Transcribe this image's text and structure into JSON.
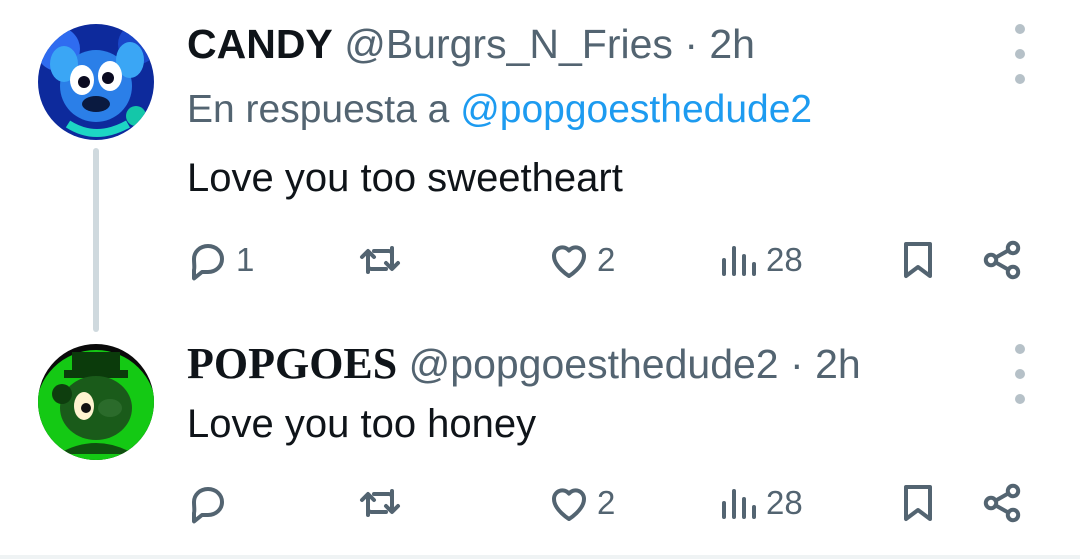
{
  "tweets": [
    {
      "display_name": "CANDY",
      "handle": "@Burgrs_N_Fries",
      "separator": "·",
      "time": "2h",
      "reply_prefix": "En respuesta a",
      "reply_to": "@popgoesthedude2",
      "text": "Love you too sweetheart",
      "replies": "1",
      "retweets": "",
      "likes": "2",
      "views": "28"
    },
    {
      "display_name": "POPGOES",
      "handle": "@popgoesthedude2",
      "separator": "·",
      "time": "2h",
      "text": "Love you too honey",
      "replies": "",
      "retweets": "",
      "likes": "2",
      "views": "28"
    }
  ],
  "icons": {
    "reply": "reply-icon",
    "retweet": "retweet-icon",
    "like": "heart-icon",
    "views": "views-chart-icon",
    "bookmark": "bookmark-icon",
    "share": "share-icon",
    "more": "more-vertical-icon"
  },
  "colors": {
    "mention": "#1d9bf0",
    "muted": "#536471",
    "text": "#0f1419",
    "thread_line": "#cfd9de",
    "avatar_candy": "#1e4fd8",
    "avatar_popgoes": "#1bd31b"
  }
}
